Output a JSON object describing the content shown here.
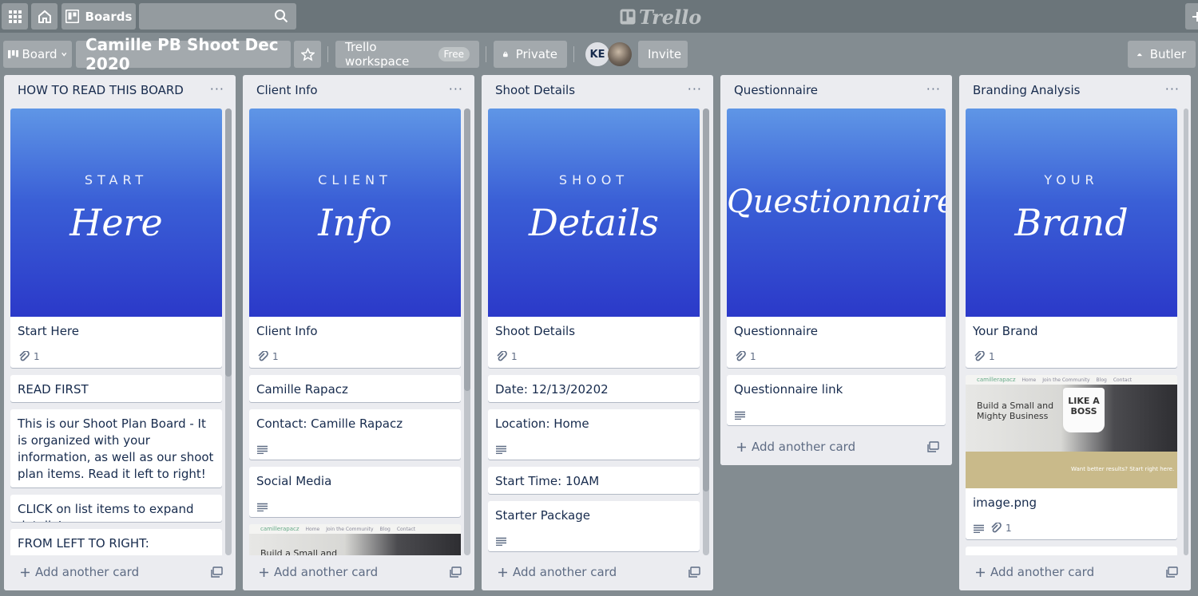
{
  "header": {
    "boards_label": "Boards",
    "logo_text": "Trello"
  },
  "board_header": {
    "view_label": "Board",
    "board_title": "Camille PB Shoot Dec 2020",
    "workspace_label": "Trello workspace",
    "workspace_badge": "Free",
    "visibility_label": "Private",
    "member_initials": "KE",
    "invite_label": "Invite",
    "butler_label": "Butler"
  },
  "lists": [
    {
      "title": "HOW TO READ THIS BOARD",
      "cover": {
        "small": "START",
        "big": "Here"
      },
      "cards": [
        {
          "title": "Start Here",
          "attachments": "1"
        },
        {
          "title": "READ FIRST"
        },
        {
          "title": "This is our Shoot Plan Board - It is organized with your information, as well as our shoot plan items. Read it left to right!"
        },
        {
          "title": "CLICK on list items to expand details!"
        },
        {
          "title": "FROM LEFT TO RIGHT:"
        }
      ],
      "add_card_label": "Add another card"
    },
    {
      "title": "Client Info",
      "cover": {
        "small": "CLIENT",
        "big": "Info"
      },
      "cards": [
        {
          "title": "Client Info",
          "attachments": "1"
        },
        {
          "title": "Camille Rapacz"
        },
        {
          "title": "Contact: Camille Rapacz"
        },
        {
          "title": "Social Media"
        }
      ],
      "add_card_label": "Add another card"
    },
    {
      "title": "Shoot Details",
      "cover": {
        "small": "SHOOT",
        "big": "Details"
      },
      "cards": [
        {
          "title": "Shoot Details",
          "attachments": "1"
        },
        {
          "title": "Date: 12/13/20202"
        },
        {
          "title": "Location: Home"
        },
        {
          "title": "Start Time: 10AM"
        },
        {
          "title": "Starter Package"
        }
      ],
      "add_card_label": "Add another card"
    },
    {
      "title": "Questionnaire",
      "cover": {
        "big": "Questionnaire"
      },
      "cards": [
        {
          "title": "Questionnaire",
          "attachments": "1"
        },
        {
          "title": "Questionnaire link"
        }
      ],
      "add_card_label": "Add another card"
    },
    {
      "title": "Branding Analysis",
      "cover": {
        "small": "YOUR",
        "big": "Brand"
      },
      "cards": [
        {
          "title": "Your Brand",
          "attachments": "1"
        },
        {
          "title": "image.png",
          "attachments": "1"
        }
      ],
      "add_card_label": "Add another card"
    }
  ],
  "website_thumb": {
    "brand": "camillerapacz",
    "nav_items": [
      "Home",
      "Join the Community",
      "Blog",
      "Contact"
    ],
    "headline": "Build a Small and Mighty Business",
    "mug_text": "LIKE A BOSS",
    "cta": "Want better results? Start right here."
  },
  "colors": {
    "board_bg": "#838c91",
    "list_bg": "#ebecf0",
    "cover_top": "#5f96e6",
    "cover_bottom": "#2b39c9"
  }
}
